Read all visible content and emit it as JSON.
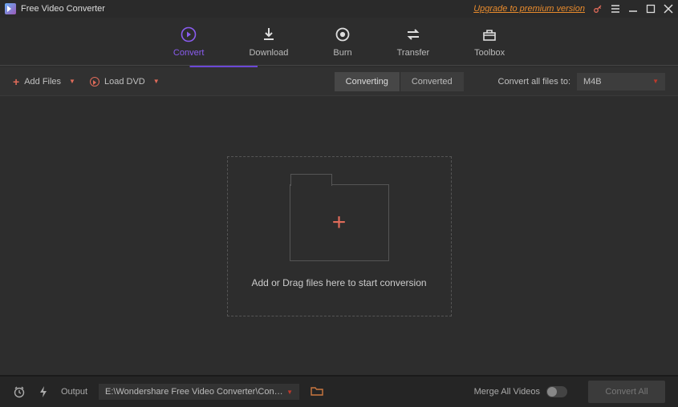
{
  "titlebar": {
    "app_name": "Free Video Converter",
    "upgrade_text": "Upgrade to premium version"
  },
  "nav": {
    "convert": "Convert",
    "download": "Download",
    "burn": "Burn",
    "transfer": "Transfer",
    "toolbox": "Toolbox"
  },
  "actions": {
    "add_files": "Add Files",
    "load_dvd": "Load DVD",
    "converting": "Converting",
    "converted": "Converted",
    "convert_all_to": "Convert all files to:",
    "selected_format": "M4B"
  },
  "dropzone": {
    "text": "Add or Drag files here to start conversion"
  },
  "bottom": {
    "output_label": "Output",
    "output_path": "E:\\Wondershare Free Video Converter\\Converted",
    "merge_label": "Merge All Videos",
    "convert_all": "Convert All"
  }
}
